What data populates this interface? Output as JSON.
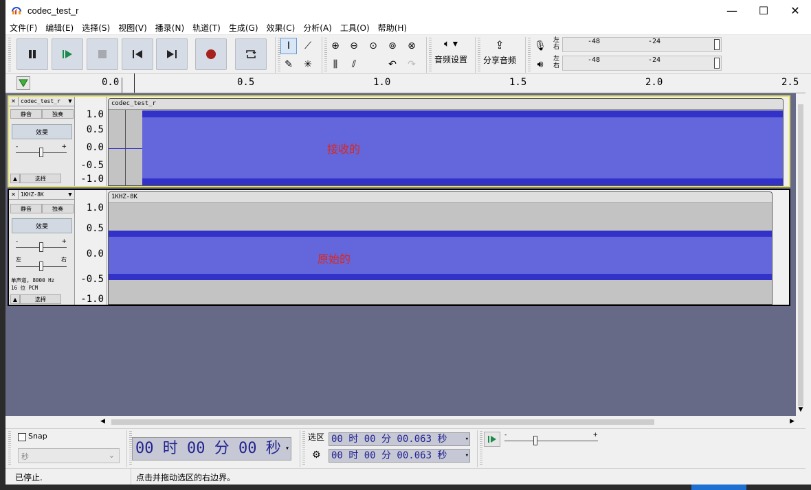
{
  "window": {
    "title": "codec_test_r"
  },
  "menu": [
    "文件(F)",
    "编辑(E)",
    "选择(S)",
    "视图(V)",
    "播录(N)",
    "轨道(T)",
    "生成(G)",
    "效果(C)",
    "分析(A)",
    "工具(O)",
    "帮助(H)"
  ],
  "toolbar": {
    "audio_settings": "音频设置",
    "share_audio": "分享音频",
    "meter_left": "左",
    "meter_right": "右",
    "meter_ticks": [
      "-48",
      "-24"
    ]
  },
  "ruler": {
    "ticks": [
      "0.0",
      "0.5",
      "1.0",
      "1.5",
      "2.0",
      "2.5"
    ]
  },
  "tracks": [
    {
      "name": "codec_test_r",
      "clip_name": "codec_test_r",
      "mute": "静音",
      "solo": "独奏",
      "effects": "效果",
      "select": "选择",
      "scale": [
        "1.0",
        "0.5",
        "0.0",
        "-0.5",
        "-1.0"
      ],
      "annotation": "接收的",
      "gain_level": 0.5
    },
    {
      "name": "1KHZ-8K",
      "clip_name": "1KHZ-8K",
      "mute": "静音",
      "solo": "独奏",
      "effects": "效果",
      "select": "选择",
      "pan_left": "左",
      "pan_right": "右",
      "info_line1": "单声道, 8000 Hz",
      "info_line2": "16 位 PCM",
      "scale": [
        "1.0",
        "0.5",
        "0.0",
        "-0.5",
        "-1.0"
      ],
      "annotation": "原始的",
      "gain_level": 0.5,
      "pan_level": 0.5
    }
  ],
  "bottom": {
    "snap_label": "Snap",
    "unit_select": "秒",
    "time_main": "00 时 00 分 00 秒",
    "selection_label": "选区",
    "sel_start": "00 时 00 分 00.063 秒",
    "sel_end": "00 时 00 分 00.063 秒"
  },
  "status": {
    "left": "已停止.",
    "right": "点击并拖动选区的右边界。"
  }
}
